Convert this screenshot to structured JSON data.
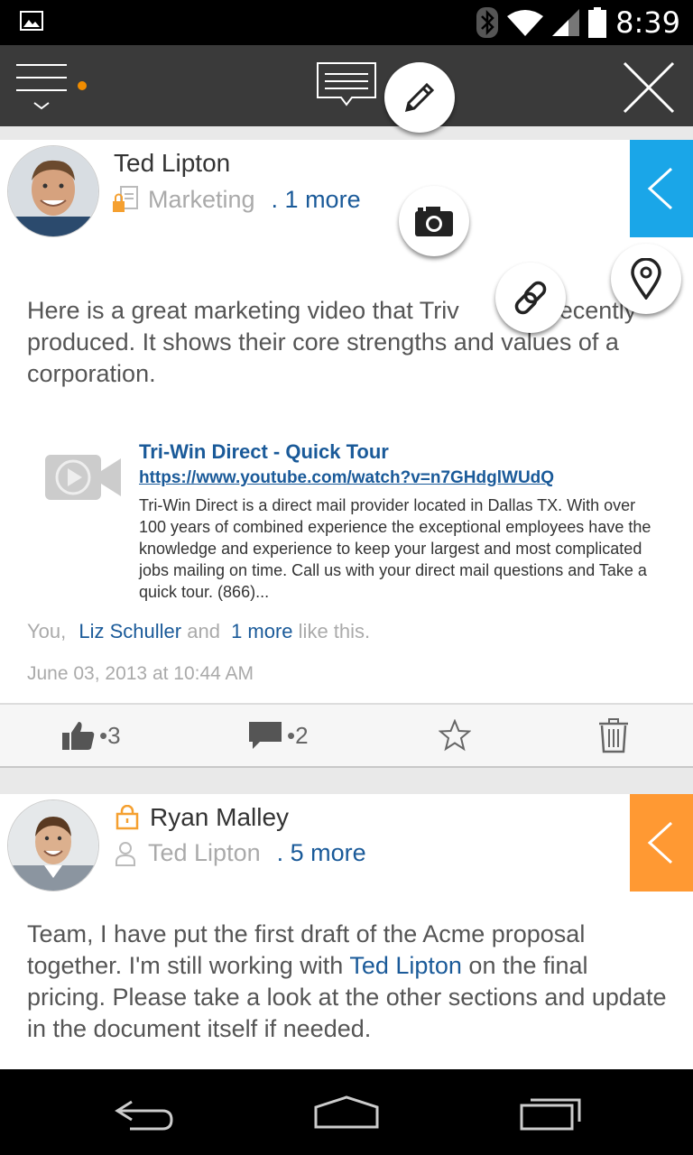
{
  "status_bar": {
    "time": "8:39"
  },
  "posts": [
    {
      "author": "Ted Lipton",
      "group": "Marketing",
      "more": ". 1 more",
      "body_before": "Here is a great marketing video that Triv",
      "body_after": "as recently produced. It shows their core strengths and values of a corporation.",
      "link": {
        "title": "Tri-Win Direct - Quick Tour",
        "url": "https://www.youtube.com/watch?v=n7GHdglWUdQ",
        "description": "Tri-Win Direct is a direct mail provider located in Dallas TX. With over 100 years of combined experience the exceptional employees have the knowledge and experience to keep your largest and most complicated jobs mailing on time. Call us with your direct mail questions and Take a quick tour. (866)..."
      },
      "likes": {
        "you": "You,",
        "name": "Liz Schuller",
        "and": "and",
        "more": "1 more",
        "suffix": "like this."
      },
      "timestamp": "June 03, 2013 at 10:44 AM",
      "like_count": "•3",
      "comment_count": "•2",
      "tab_color": "#1aa6e8"
    },
    {
      "author": "Ryan Malley",
      "recipient": "Ted Lipton",
      "more": ". 5 more",
      "body_1": "Team, I have put the first draft of the Acme proposal together. I'm still working with ",
      "body_mention": "Ted Lipton",
      "body_2": " on the final pricing. Please take a look at the other sections and update in the document itself if needed.",
      "tab_color": "#ff9933"
    }
  ],
  "colors": {
    "accent_blue": "#1aa6e8",
    "accent_orange": "#ff9933",
    "link_blue": "#1a5a99",
    "actionbar": "#3a3a3a"
  }
}
